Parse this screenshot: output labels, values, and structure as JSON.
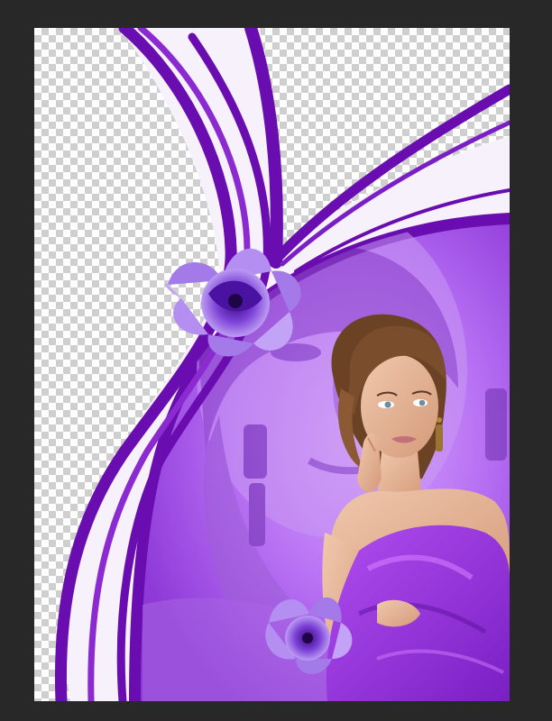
{
  "app": {
    "canvas_background": "transparency-checkerboard",
    "workspace_color": "#282828"
  },
  "artwork": {
    "theme_colors": {
      "deep_purple": "#6a0db0",
      "mid_purple": "#9b3fe0",
      "lavender": "#c08cf5",
      "pale_lilac": "#f7f1fb",
      "skin": "#e7b899",
      "hair": "#7a4e2c"
    },
    "elements": [
      "swoosh-ribbons",
      "purple-oval-frame",
      "faded-face-photo",
      "woman-portrait",
      "purple-flower-top",
      "purple-flower-bottom"
    ]
  }
}
